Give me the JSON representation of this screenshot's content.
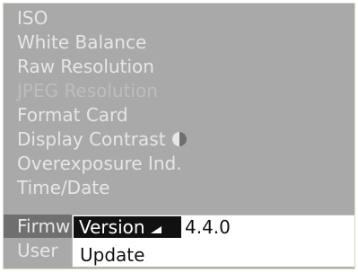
{
  "menu": {
    "items": [
      {
        "label": "ISO",
        "state": "enabled"
      },
      {
        "label": "White Balance",
        "state": "enabled"
      },
      {
        "label": "Raw Resolution",
        "state": "enabled"
      },
      {
        "label": "JPEG Resolution",
        "state": "disabled"
      },
      {
        "label": "Format Card",
        "state": "enabled"
      },
      {
        "label": "Display Contrast",
        "state": "enabled",
        "icon": "contrast-icon"
      },
      {
        "label": "Overexposure Ind.",
        "state": "enabled"
      },
      {
        "label": "Time/Date",
        "state": "enabled"
      },
      {
        "label": "Firmw",
        "state": "selected"
      },
      {
        "label": "User",
        "state": "enabled"
      }
    ]
  },
  "submenu": {
    "version_label": "Version",
    "version_value": "4.4.0",
    "update_label": "Update"
  },
  "colors": {
    "menu_background": "#a9a9a9",
    "selection_background": "#111111",
    "submenu_background": "#ffffff"
  }
}
